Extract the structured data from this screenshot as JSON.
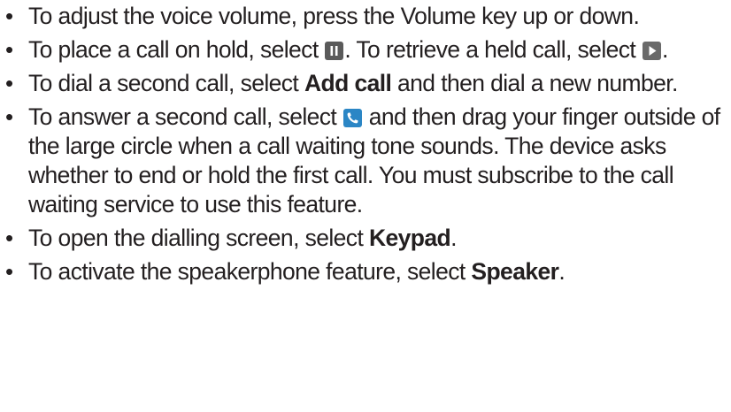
{
  "bullet_symbol": "•",
  "items": [
    {
      "text": "To adjust the voice volume, press the Volume key up or down."
    },
    {
      "before": "To place a call on hold, select ",
      "icon1": "pause-icon",
      "middle": ". To retrieve a held call, select ",
      "icon2": "play-icon",
      "after": "."
    },
    {
      "before": "To dial a second call, select ",
      "bold": "Add call",
      "after": " and then dial a new number."
    },
    {
      "before": "To answer a second call, select ",
      "icon": "phone-answer-icon",
      "after": " and then drag your finger outside of the large circle when a call waiting tone sounds. The device asks whether to end or hold the first call. You must subscribe to the call waiting service to use this feature."
    },
    {
      "before": "To open the dialling screen, select ",
      "bold": "Keypad",
      "after": "."
    },
    {
      "before": "To activate the speakerphone feature, select ",
      "bold": "Speaker",
      "after": "."
    }
  ],
  "colors": {
    "text": "#231f20",
    "pause_icon_bg": "#5a5a5a",
    "play_icon_bg": "#6a6a6a",
    "answer_icon_bg": "#2b86c5"
  }
}
